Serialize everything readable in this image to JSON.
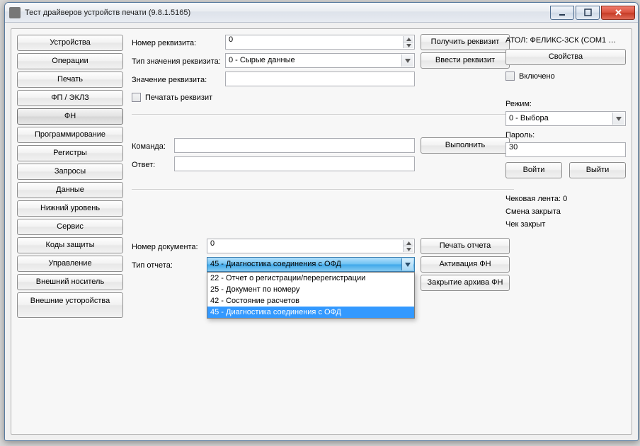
{
  "window": {
    "title": "Тест драйверов устройств печати (9.8.1.5165)"
  },
  "sidebar": {
    "items": [
      {
        "label": "Устройства"
      },
      {
        "label": "Операции"
      },
      {
        "label": "Печать"
      },
      {
        "label": "ФП / ЭКЛЗ"
      },
      {
        "label": "ФН"
      },
      {
        "label": "Программирование"
      },
      {
        "label": "Регистры"
      },
      {
        "label": "Запросы"
      },
      {
        "label": "Данные"
      },
      {
        "label": "Нижний уровень"
      },
      {
        "label": "Сервис"
      },
      {
        "label": "Коды защиты"
      },
      {
        "label": "Управление"
      },
      {
        "label": "Внешний носитель"
      },
      {
        "label": "Внешние усторойства"
      }
    ],
    "active_index": 4
  },
  "requisite": {
    "number_label": "Номер реквизита:",
    "number_value": "0",
    "type_label": "Тип значения реквизита:",
    "type_value": "0 - Сырые данные",
    "value_label": "Значение реквизита:",
    "value_value": "",
    "print_check_label": "Печатать реквизит",
    "get_btn": "Получить реквизит",
    "set_btn": "Ввести реквизит"
  },
  "command": {
    "cmd_label": "Команда:",
    "cmd_value": "",
    "ans_label": "Ответ:",
    "ans_value": "",
    "exec_btn": "Выполнить"
  },
  "report": {
    "doc_label": "Номер документа:",
    "doc_value": "0",
    "type_label": "Тип отчета:",
    "type_value": "45 - Диагностика соединения с ОФД",
    "print_btn": "Печать отчета",
    "activate_btn": "Активация ФН",
    "close_archive_btn": "Закрытие архива ФН",
    "dropdown_items": [
      "22 - Отчет о регистрации/перерегистрации",
      "25 - Документ по номеру",
      "42 - Состояние расчетов",
      "45 - Диагностика соединения с ОФД"
    ],
    "dropdown_selected_index": 3
  },
  "right": {
    "device": "АТОЛ: ФЕЛИКС-3СК (COM1 …",
    "props_btn": "Свойства",
    "enabled_label": "Включено",
    "mode_label": "Режим:",
    "mode_value": "0 - Выбора",
    "password_label": "Пароль:",
    "password_value": "30",
    "login_btn": "Войти",
    "logout_btn": "Выйти",
    "tape": "Чековая лента: 0",
    "shift": "Смена закрыта",
    "cheque": "Чек закрыт"
  }
}
